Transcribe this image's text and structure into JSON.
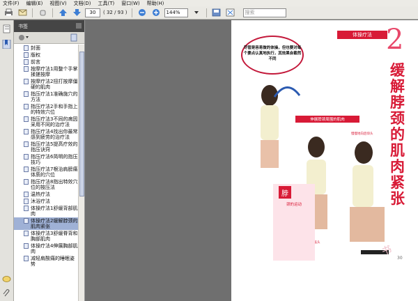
{
  "menu": [
    "文件(F)",
    "编辑(E)",
    "视图(V)",
    "文档(D)",
    "工具(T)",
    "窗口(W)",
    "帮助(H)"
  ],
  "toolbar": {
    "page_current": "30",
    "page_count": "( 32 / 93 )",
    "zoom": "144%",
    "search_placeholder": "搜索"
  },
  "panel": {
    "title": "书签",
    "bookmarks": [
      "封面",
      "版权",
      "前言",
      "按摩疗法1用整个手掌揉搓按摩",
      "按摩疗法2扭打按摩僵硬的肌肉",
      "指压疗法1准确施穴的方法",
      "指压疗法2手和手指上的特效穴位",
      "指压疗法3不同的病因采用不同的治疗法",
      "指压疗法4找出你最常感到疲劳的治疗法",
      "指压疗法5提高疗效的指压诀窍",
      "指压疗法6简明的指压技巧",
      "指压疗法7根治肩膀痛体质的穴位",
      "指压疗法8指出特效穴位的按压法",
      "温热疗法",
      "沐浴疗法",
      "体操疗法1舒缓背部肌肉",
      "体操疗法2缓解脖颈的肌肉紧张",
      "体操疗法3舒缓脊背和胸部肌肉",
      "体操疗法4伸展胸部肌肉",
      "减轻肩酸痛的睡眠姿势"
    ],
    "selected_index": 16
  },
  "page": {
    "section_label": "体操疗法",
    "chapter_number": "2",
    "title": "缓解脖颈的肌肉紧张",
    "callout": "尽管是容易做的体操，但也要对每个要点认真地执行，其效果会截然不同",
    "strip_label": "伸展脖颈周围的肌肉",
    "box_number": "脖",
    "box_heading": "颈的运动",
    "page_number": "30",
    "stamp": "书",
    "caption_1": "慢慢地向下低头",
    "caption_2": "慢慢地向后仰头"
  }
}
